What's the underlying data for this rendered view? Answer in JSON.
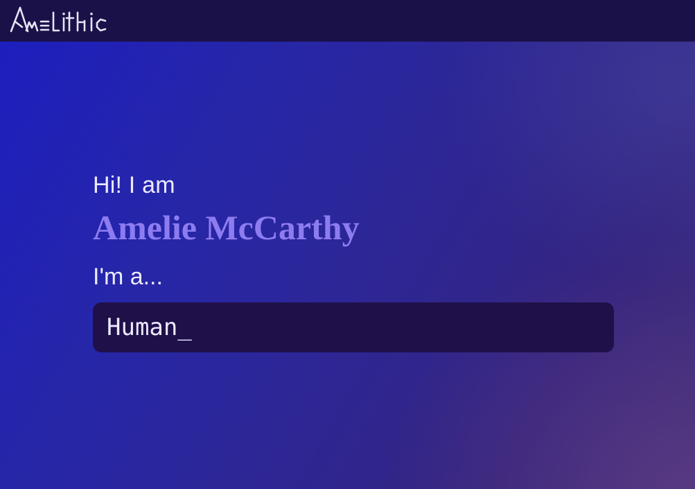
{
  "header": {
    "logo_text": "Amelithic"
  },
  "hero": {
    "greeting": "Hi! I am",
    "name": "Amelie McCarthy",
    "role_prefix": "I'm a...",
    "role_text": "Human_"
  },
  "colors": {
    "header_bg": "#1b1149",
    "name_accent": "#8d7cf0",
    "text_light": "#ece9ff",
    "role_box_bg": "#1f1049"
  }
}
